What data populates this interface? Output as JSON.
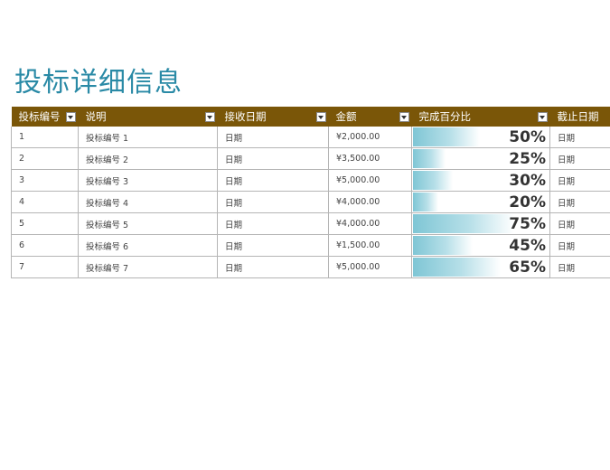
{
  "title": "投标详细信息",
  "columns": [
    "投标编号",
    "说明",
    "接收日期",
    "金额",
    "完成百分比",
    "截止日期"
  ],
  "rows": [
    {
      "id": "1",
      "desc": "投标编号 1",
      "received": "日期",
      "amount": "¥2,000.00",
      "pct_label": "50%",
      "pct": 0.5,
      "due": "日期"
    },
    {
      "id": "2",
      "desc": "投标编号 2",
      "received": "日期",
      "amount": "¥3,500.00",
      "pct_label": "25%",
      "pct": 0.25,
      "due": "日期"
    },
    {
      "id": "3",
      "desc": "投标编号 3",
      "received": "日期",
      "amount": "¥5,000.00",
      "pct_label": "30%",
      "pct": 0.3,
      "due": "日期"
    },
    {
      "id": "4",
      "desc": "投标编号 4",
      "received": "日期",
      "amount": "¥4,000.00",
      "pct_label": "20%",
      "pct": 0.2,
      "due": "日期"
    },
    {
      "id": "5",
      "desc": "投标编号 5",
      "received": "日期",
      "amount": "¥4,000.00",
      "pct_label": "75%",
      "pct": 0.75,
      "due": "日期"
    },
    {
      "id": "6",
      "desc": "投标编号 6",
      "received": "日期",
      "amount": "¥1,500.00",
      "pct_label": "45%",
      "pct": 0.45,
      "due": "日期"
    },
    {
      "id": "7",
      "desc": "投标编号 7",
      "received": "日期",
      "amount": "¥5,000.00",
      "pct_label": "65%",
      "pct": 0.65,
      "due": "日期"
    }
  ],
  "colors": {
    "header_bg": "#7a5608",
    "title": "#2a8aa6",
    "bar": "#7fc6d5"
  },
  "icons": {
    "filter": "filter-dropdown-icon"
  }
}
